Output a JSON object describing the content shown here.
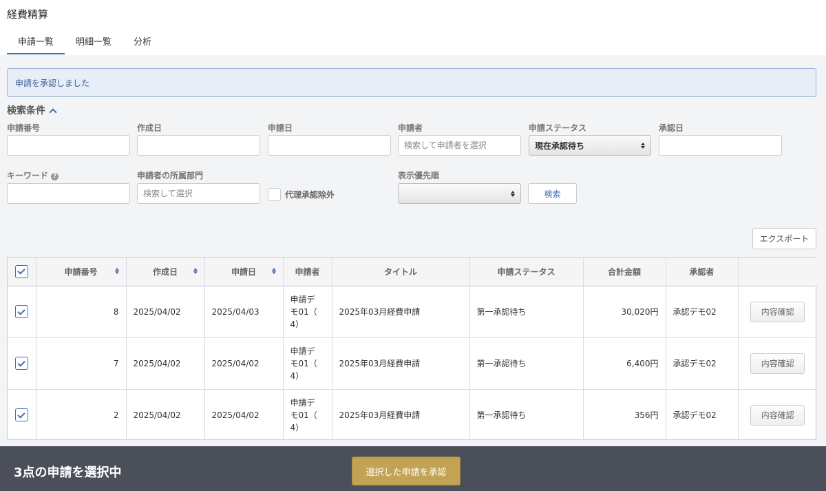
{
  "app": {
    "title": "経費精算"
  },
  "tabs": [
    {
      "label": "申請一覧",
      "active": true
    },
    {
      "label": "明細一覧",
      "active": false
    },
    {
      "label": "分析",
      "active": false
    }
  ],
  "alert": {
    "message": "申請を承認しました"
  },
  "search": {
    "title": "検索条件",
    "fields": {
      "request_no": {
        "label": "申請番号",
        "value": ""
      },
      "created_date": {
        "label": "作成日",
        "value": ""
      },
      "request_date": {
        "label": "申請日",
        "value": ""
      },
      "applicant": {
        "label": "申請者",
        "placeholder": "検索して申請者を選択"
      },
      "status": {
        "label": "申請ステータス",
        "selected": "現在承認待ち"
      },
      "approved_date": {
        "label": "承認日",
        "value": ""
      },
      "keyword": {
        "label": "キーワード",
        "value": ""
      },
      "department": {
        "label": "申請者の所属部門",
        "placeholder": "検索して選択"
      },
      "proxy_exclude": {
        "label": "代理承認除外",
        "checked": false
      },
      "priority": {
        "label": "表示優先順",
        "selected": ""
      }
    },
    "search_button": "検索"
  },
  "export_button": "エクスポート",
  "table": {
    "columns": [
      "申請番号",
      "作成日",
      "申請日",
      "申請者",
      "タイトル",
      "申請ステータス",
      "合計金額",
      "承認者"
    ],
    "rows": [
      {
        "no": "8",
        "created": "2025/04/02",
        "requested": "2025/04/03",
        "applicant_lines": [
          "申請デ",
          "モ01（",
          "4）"
        ],
        "title": "2025年03月経費申請",
        "status": "第一承認待ち",
        "amount": "30,020円",
        "approver": "承認デモ02",
        "action": "内容確認",
        "checked": true
      },
      {
        "no": "7",
        "created": "2025/04/02",
        "requested": "2025/04/02",
        "applicant_lines": [
          "申請デ",
          "モ01（",
          "4）"
        ],
        "title": "2025年03月経費申請",
        "status": "第一承認待ち",
        "amount": "6,400円",
        "approver": "承認デモ02",
        "action": "内容確認",
        "checked": true
      },
      {
        "no": "2",
        "created": "2025/04/02",
        "requested": "2025/04/02",
        "applicant_lines": [
          "申請デ",
          "モ01（",
          "4）"
        ],
        "title": "2025年03月経費申請",
        "status": "第一承認待ち",
        "amount": "356円",
        "approver": "承認デモ02",
        "action": "内容確認",
        "checked": true
      }
    ]
  },
  "footer": {
    "selection_text": "3点の申請を選択中",
    "approve_button": "選択した申請を承認"
  },
  "colors": {
    "accent": "#3e6fb3",
    "approve": "#c2a253",
    "footer_bg": "#4a4f5a"
  }
}
